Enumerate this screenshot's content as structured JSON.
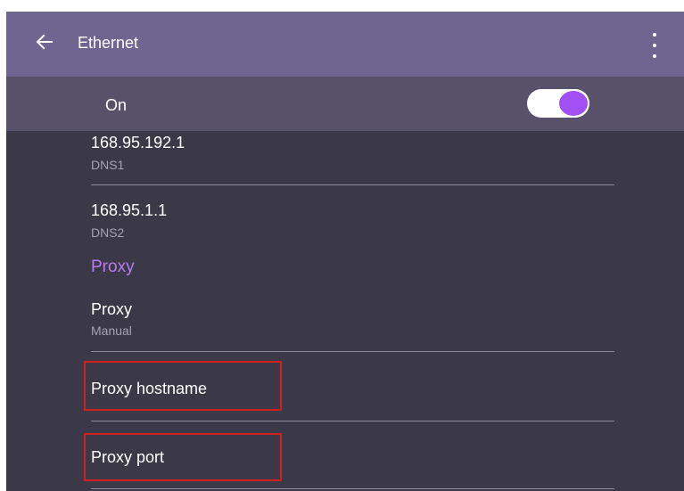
{
  "app_bar": {
    "title": "Ethernet",
    "back_icon": "arrow-back-icon",
    "menu_icon": "more-vert-icon",
    "background": "#6e6690"
  },
  "switch_bar": {
    "label": "On",
    "toggle_state": true,
    "accent": "#a24ff5"
  },
  "settings": {
    "dns1": {
      "value": "168.95.192.1",
      "label": "DNS1"
    },
    "dns2": {
      "value": "168.95.1.1",
      "label": "DNS2"
    },
    "proxy_section_header": "Proxy",
    "proxy": {
      "title": "Proxy",
      "value": "Manual"
    },
    "proxy_hostname": {
      "title": "Proxy hostname"
    },
    "proxy_port": {
      "title": "Proxy port"
    }
  },
  "colors": {
    "content_background": "#3b3847",
    "highlight": "#d0201f",
    "section_header": "#b77cf0"
  }
}
